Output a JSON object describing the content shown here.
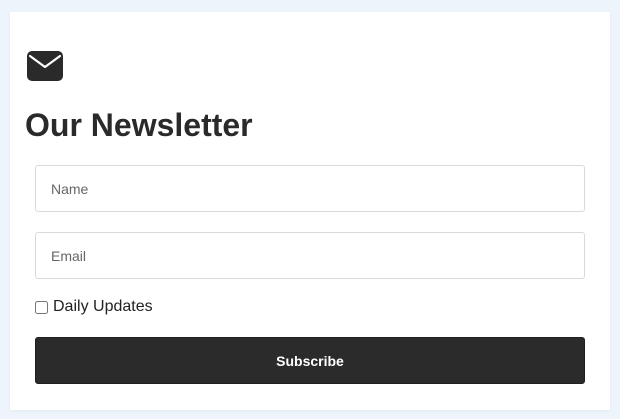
{
  "newsletter": {
    "icon": "envelope-icon",
    "title": "Our Newsletter",
    "name_placeholder": "Name",
    "email_placeholder": "Email",
    "checkbox_label": "Daily Updates",
    "checkbox_checked": false,
    "subscribe_label": "Subscribe"
  },
  "colors": {
    "page_background": "#eef4fb",
    "card_background": "#ffffff",
    "button_background": "#2b2b2b",
    "text": "#2a2a2a"
  }
}
